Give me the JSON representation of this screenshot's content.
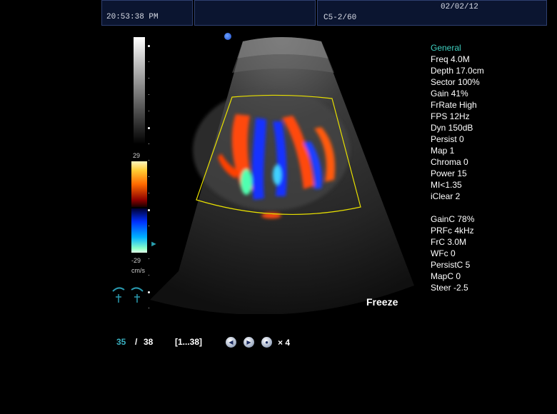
{
  "header": {
    "time": "20:53:38 PM",
    "date": "02/02/12",
    "probe": "C5-2/60"
  },
  "color_scale": {
    "top": "29",
    "bottom": "-29",
    "unit": "cm/s"
  },
  "params": {
    "section_title": "General",
    "general": [
      "Freq 4.0M",
      "Depth 17.0cm",
      "Sector 100%",
      "Gain 41%",
      "FrRate High",
      "FPS 12Hz",
      "Dyn 150dB",
      "Persist 0",
      "Map 1",
      "Chroma 0",
      "Power 15",
      "MI<1.35",
      "iClear 2"
    ],
    "color": [
      "GainC 78%",
      "PRFc 4kHz",
      "FrC 3.0M",
      "WFc 0",
      "PersistC 5",
      "MapC 0",
      "Steer -2.5"
    ]
  },
  "status": {
    "freeze": "Freeze"
  },
  "cine": {
    "current": "35",
    "separator": "/",
    "total": "38",
    "range": "[1...38]",
    "speed": "× 4"
  },
  "colors": {
    "header_bg": "#0b1530",
    "accent": "#3fd0c0",
    "roi_box": "#e8e000"
  },
  "icons": {
    "orientation": "orientation-dot-icon",
    "prev": "cine-prev-icon",
    "play": "cine-play-icon",
    "next": "cine-next-icon",
    "curve": "spline-curve-icon"
  }
}
